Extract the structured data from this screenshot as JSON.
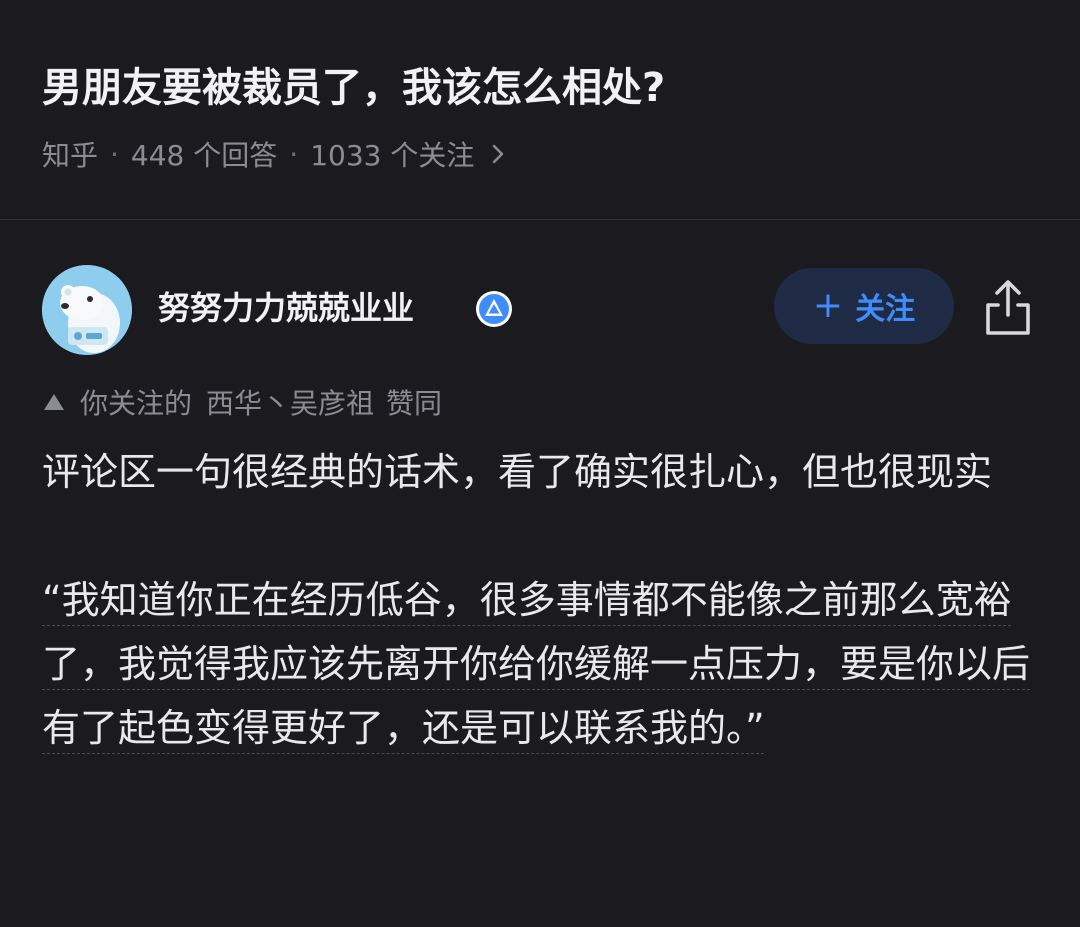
{
  "question": {
    "title": "男朋友要被裁员了，我该怎么相处?",
    "meta": {
      "source": "知乎",
      "separator": "·",
      "answers": "448 个回答",
      "followers": "1033 个关注",
      "chevron_icon": "chevron-right-icon"
    }
  },
  "author": {
    "avatar_icon": "polar-bear-avatar",
    "name": "努努力力兢兢业业",
    "badge_icon": "verified-badge-icon",
    "follow_label": "关注",
    "follow_plus": "+",
    "share_icon": "share-icon"
  },
  "social_proof": {
    "icon": "triangle-up-icon",
    "prefix": "你关注的",
    "names": "西华丶吴彦祖",
    "verb": "赞同"
  },
  "answer": {
    "paragraph1": "评论区一句很经典的话术，看了确实很扎心，但也很现实",
    "quote": "“我知道你正在经历低谷，很多事情都不能像之前那么宽裕了，我觉得我应该先离开你给你缓解一点压力，要是你以后有了起色变得更好了，还是可以联系我的。”"
  },
  "colors": {
    "background": "#1b1b1f",
    "text_primary": "#f2f2f4",
    "text_secondary": "#8b8b92",
    "accent": "#3f8dfd",
    "follow_bg": "#1f2a44"
  }
}
